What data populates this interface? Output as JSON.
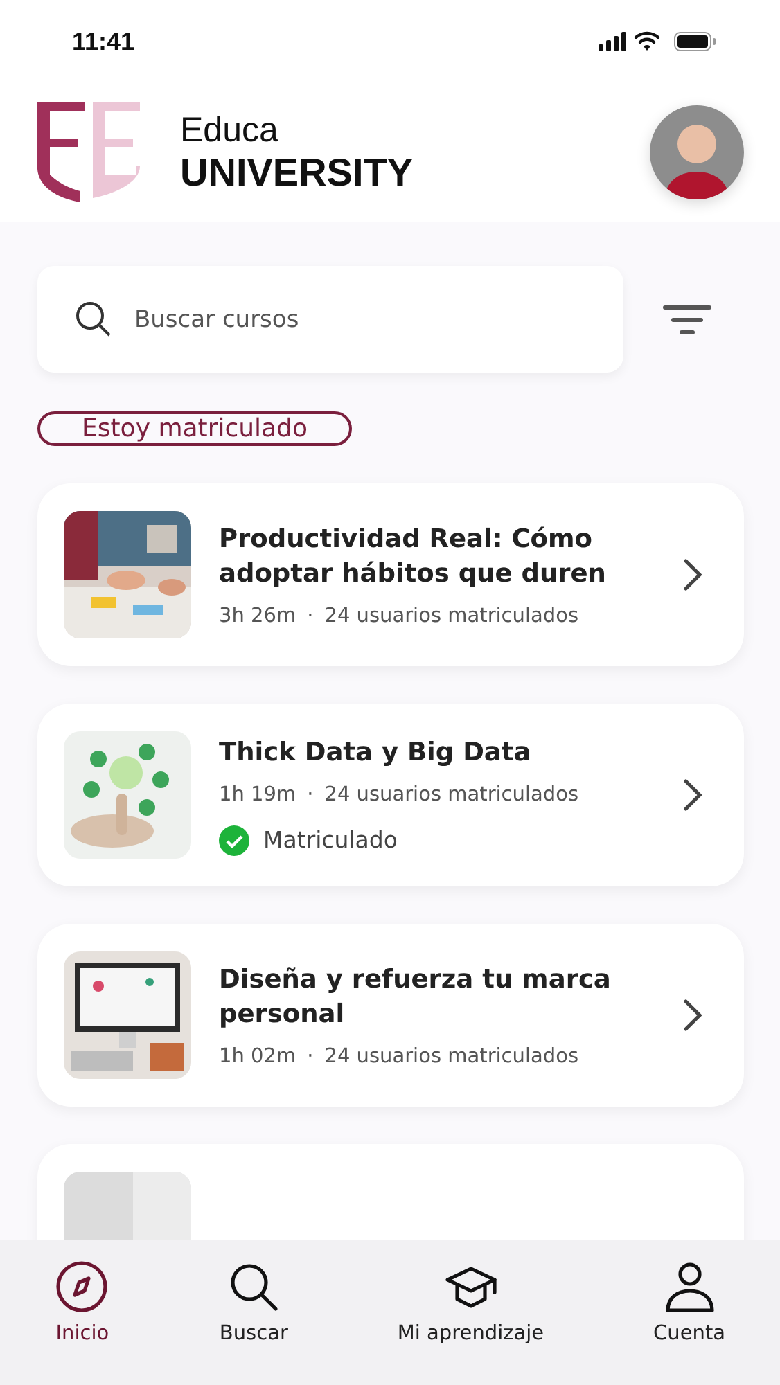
{
  "status_bar": {
    "time": "11:41"
  },
  "header": {
    "brand_line_1": "Educa",
    "brand_line_2": "UNIVERSITY"
  },
  "search": {
    "placeholder": "Buscar cursos"
  },
  "filter_chip": {
    "label": "Estoy matriculado",
    "selected": false
  },
  "courses": [
    {
      "title": "Productividad Real: Cómo adoptar hábitos que duren",
      "duration": "3h 26m",
      "separator": "·",
      "enrolled_count": "24 usuarios matriculados",
      "enrolled": false
    },
    {
      "title": "Thick Data y Big Data",
      "duration": "1h 19m",
      "separator": "·",
      "enrolled_count": "24 usuarios matriculados",
      "enrolled": true,
      "status_label": "Matriculado"
    },
    {
      "title": "Diseña y refuerza tu marca personal",
      "duration": "1h 02m",
      "separator": "·",
      "enrolled_count": "24 usuarios matriculados",
      "enrolled": false
    }
  ],
  "nav": [
    {
      "label": "Inicio",
      "selected": true
    },
    {
      "label": "Buscar",
      "selected": false
    },
    {
      "label": "Mi aprendizaje",
      "selected": false
    },
    {
      "label": "Cuenta",
      "selected": false
    }
  ]
}
